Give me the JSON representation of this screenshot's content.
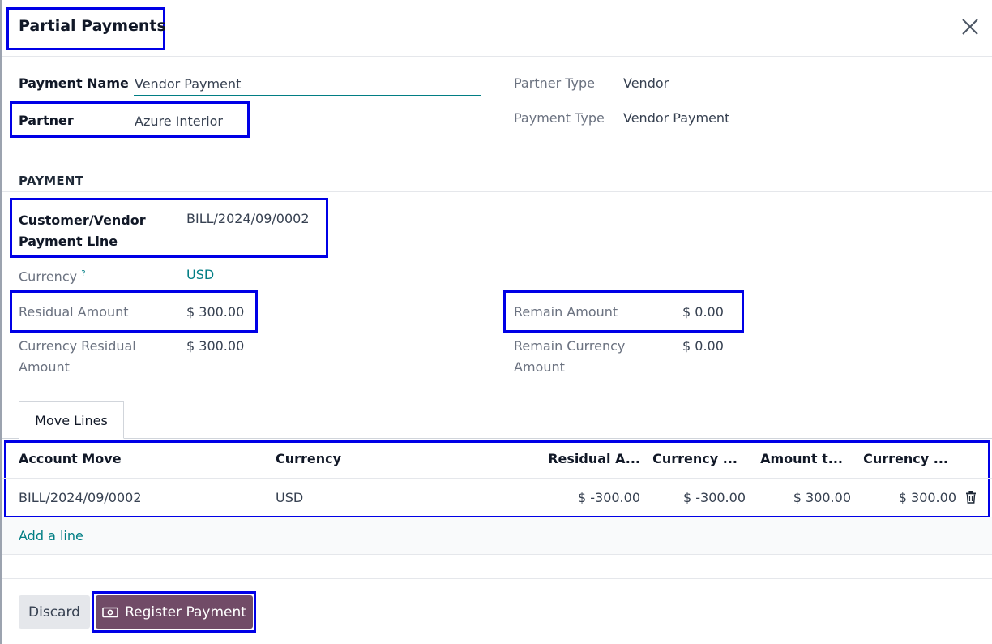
{
  "dialog": {
    "title": "Partial Payments"
  },
  "form": {
    "payment_name_label": "Payment Name",
    "payment_name_value": "Vendor Payment",
    "partner_label": "Partner",
    "partner_value": "Azure Interior",
    "partner_type_label": "Partner Type",
    "partner_type_value": "Vendor",
    "payment_type_label": "Payment Type",
    "payment_type_value": "Vendor Payment"
  },
  "payment": {
    "section_title": "PAYMENT",
    "line_label_1": "Customer/Vendor",
    "line_label_2": "Payment Line",
    "line_value": "BILL/2024/09/0002",
    "currency_label": "Currency",
    "currency_help": "?",
    "currency_value": "USD",
    "residual_label": "Residual Amount",
    "residual_value": "$ 300.00",
    "currency_residual_label_1": "Currency Residual",
    "currency_residual_label_2": "Amount",
    "currency_residual_value": "$ 300.00",
    "remain_label": "Remain Amount",
    "remain_value": "$ 0.00",
    "remain_currency_label_1": "Remain Currency",
    "remain_currency_label_2": "Amount",
    "remain_currency_value": "$ 0.00"
  },
  "tabs": [
    {
      "label": "Move Lines"
    }
  ],
  "table": {
    "headers": [
      "Account Move",
      "Currency",
      "Residual A...",
      "Currency ...",
      "Amount t...",
      "Currency ..."
    ],
    "rows": [
      [
        "BILL/2024/09/0002",
        "USD",
        "$ -300.00",
        "$ -300.00",
        "$ 300.00",
        "$ 300.00"
      ]
    ],
    "add_line": "Add a line"
  },
  "footer": {
    "discard_label": "Discard",
    "register_label": "Register Payment"
  },
  "colors": {
    "primary": "#714b67",
    "link": "#017e84",
    "highlight": "#0000e6"
  }
}
